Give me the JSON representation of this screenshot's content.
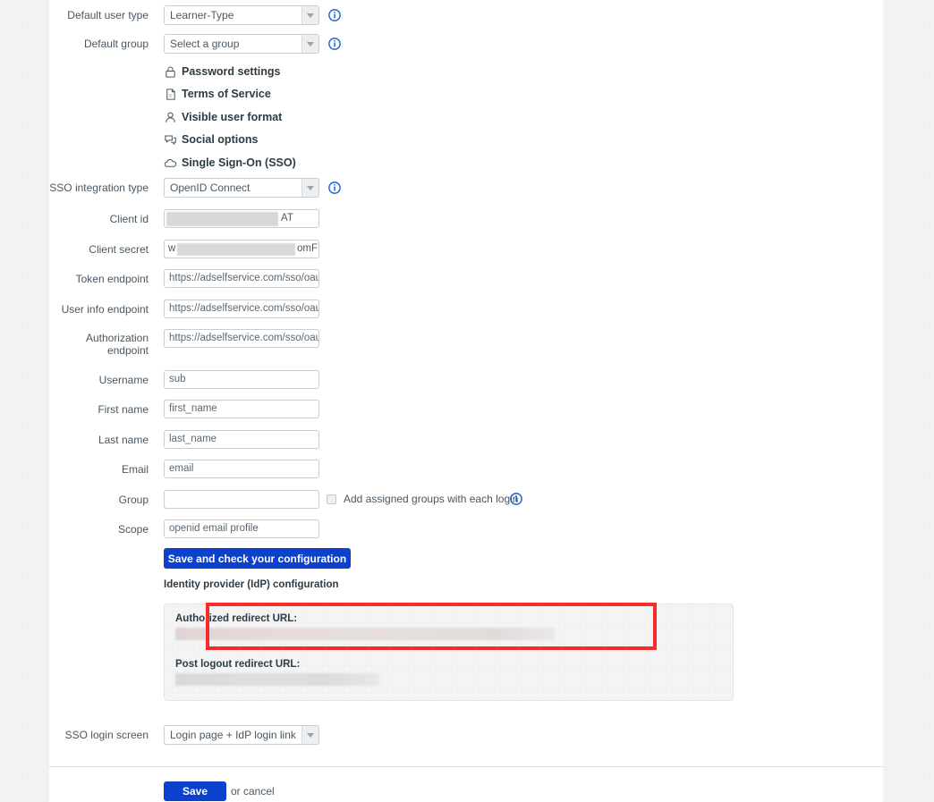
{
  "form": {
    "rows": [
      {
        "label": "Default user type",
        "type": "select",
        "value": "Learner-Type",
        "info": true
      },
      {
        "label": "Default group",
        "type": "select",
        "value": "Select a group",
        "info": true
      }
    ],
    "section_links": [
      {
        "icon": "lock-icon",
        "label": "Password settings"
      },
      {
        "icon": "document-icon",
        "label": "Terms of Service"
      },
      {
        "icon": "user-icon",
        "label": "Visible user format"
      },
      {
        "icon": "social-chat-icon",
        "label": "Social options"
      },
      {
        "icon": "cloud-icon",
        "label": "Single Sign-On (SSO)"
      }
    ],
    "sso_integration_type": {
      "label": "SSO integration type",
      "value": "OpenID Connect",
      "info": true
    },
    "client_id": {
      "label": "Client id",
      "visible_suffix": "AT",
      "redacted": true
    },
    "client_secret": {
      "label": "Client secret",
      "visible_prefix": "w",
      "visible_suffix": "omF",
      "redacted": true
    },
    "endpoints": [
      {
        "label": "Token endpoint",
        "value": "https://adselfservice.com/sso/oauth/"
      },
      {
        "label": "User info endpoint",
        "value": "https://adselfservice.com/sso/oauth/"
      },
      {
        "label": "Authorization\nendpoint",
        "value": "https://adselfservice.com/sso/oauth/"
      }
    ],
    "attribute_fields": [
      {
        "label": "Username",
        "value": "sub"
      },
      {
        "label": "First name",
        "value": "first_name"
      },
      {
        "label": "Last name",
        "value": "last_name"
      },
      {
        "label": "Email",
        "value": "email"
      }
    ],
    "group_row": {
      "label": "Group",
      "value": "",
      "checkbox_label": "Add assigned groups with each login",
      "checked": false,
      "info": true
    },
    "scope_row": {
      "label": "Scope",
      "value": "openid email profile"
    },
    "save_check_button": "Save and check your configuration",
    "sso_login_screen": {
      "label": "SSO login screen",
      "value": "Login page + IdP login link"
    }
  },
  "idp": {
    "heading": "Identity provider (IdP) configuration",
    "authorized_redirect_label": "Authorized redirect URL:",
    "authorized_redirect_value": "",
    "post_logout_label": "Post logout redirect URL:",
    "post_logout_value": ""
  },
  "footer": {
    "save_label": "Save",
    "cancel_text": "or cancel"
  },
  "colors": {
    "primary_blue": "#0c41cd",
    "info_blue": "#1c5ccc",
    "highlight_red": "#f92a2a",
    "label_gray": "#4a5762",
    "panel_bg": "#f4f4f4"
  }
}
